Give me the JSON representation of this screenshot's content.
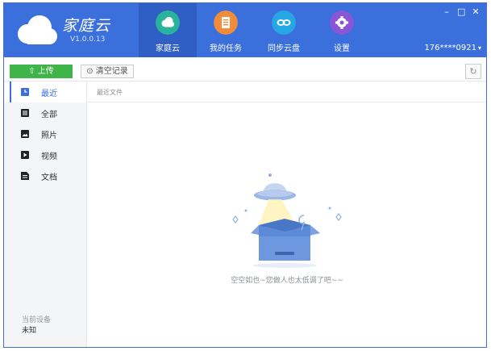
{
  "app": {
    "name": "家庭云",
    "version": "V1.0.0.13",
    "window_controls": {
      "minimize": "–",
      "maximize": "□",
      "close": "✕"
    }
  },
  "nav": {
    "items": [
      {
        "label": "家庭云",
        "icon": "cloud-icon",
        "color": "#2ab39c",
        "active": true
      },
      {
        "label": "我的任务",
        "icon": "task-list-icon",
        "color": "#f08c3a",
        "active": false
      },
      {
        "label": "同步云盘",
        "icon": "sync-icon",
        "color": "#27a6e5",
        "active": false
      },
      {
        "label": "设置",
        "icon": "gear-icon",
        "color": "#8a56d6",
        "active": false
      }
    ]
  },
  "user": {
    "account": "176****0921",
    "caret": "▾"
  },
  "toolbar": {
    "upload_label": "⇧ 上传",
    "clear_label": "⊙ 清空记录",
    "refresh_label": "↻"
  },
  "sidebar": {
    "items": [
      {
        "label": "最近",
        "icon": "recent-icon"
      },
      {
        "label": "全部",
        "icon": "all-files-icon"
      },
      {
        "label": "照片",
        "icon": "photo-icon"
      },
      {
        "label": "视频",
        "icon": "video-icon"
      },
      {
        "label": "文档",
        "icon": "document-icon"
      }
    ],
    "active_index": 0,
    "device_title": "当前设备",
    "device_value": "未知"
  },
  "main": {
    "title": "最近文件",
    "empty_message": "空空如也~您做人也太低调了吧~~"
  },
  "colors": {
    "brand_blue": "#3a6fdc",
    "upload_green": "#3fb449"
  }
}
